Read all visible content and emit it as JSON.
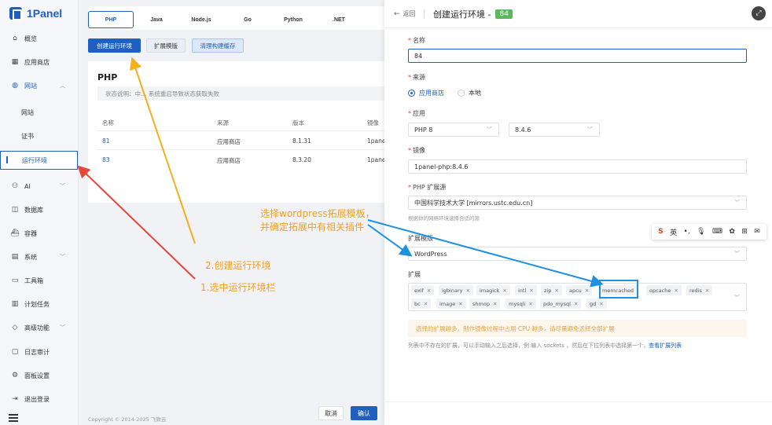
{
  "brand": "1Panel",
  "sidebar": {
    "items": [
      {
        "label": "概览",
        "icon": "home-icon"
      },
      {
        "label": "应用商店",
        "icon": "apps-icon"
      },
      {
        "label": "网站",
        "icon": "globe-icon"
      },
      {
        "label": "网站",
        "icon": ""
      },
      {
        "label": "证书",
        "icon": ""
      },
      {
        "label": "运行环境",
        "icon": ""
      },
      {
        "label": "AI",
        "icon": "robot-icon"
      },
      {
        "label": "数据库",
        "icon": "database-icon"
      },
      {
        "label": "容器",
        "icon": "container-icon"
      },
      {
        "label": "系统",
        "icon": "system-icon"
      },
      {
        "label": "工具箱",
        "icon": "toolbox-icon"
      },
      {
        "label": "计划任务",
        "icon": "schedule-icon"
      },
      {
        "label": "高级功能",
        "icon": "diamond-icon"
      },
      {
        "label": "日志审计",
        "icon": "log-icon"
      },
      {
        "label": "面板设置",
        "icon": "settings-icon"
      },
      {
        "label": "退出登录",
        "icon": "logout-icon"
      }
    ]
  },
  "runtime_tabs": [
    "PHP",
    "Java",
    "Node.js",
    "Go",
    "Python",
    ".NET"
  ],
  "toolbar": {
    "create": "创建运行环境",
    "extension_template": "扩展模版",
    "clear_cache": "清理构建缓存"
  },
  "panel": {
    "title": "PHP",
    "status": "状态说明：中… 系统重启导致状态获取失败",
    "columns": [
      "名称",
      "来源",
      "版本",
      "镜像"
    ],
    "rows": [
      {
        "name": "81",
        "source": "应用商店",
        "version": "8.1.31",
        "image": "1pane"
      },
      {
        "name": "83",
        "source": "应用商店",
        "version": "8.3.20",
        "image": "1pane"
      }
    ]
  },
  "footer": "Copyright © 2014-2025 飞致云",
  "annotations": {
    "wp_line1": "选择wordpress拓展模板，",
    "wp_line2": "并确定拓展中有相关插件",
    "step2": "2.创建运行环境",
    "step1": "1.选中运行环境栏"
  },
  "drawer": {
    "back": "返回",
    "title": "创建运行环境 -",
    "title_tag": "84",
    "fields": {
      "name_label": "名称",
      "name_value": "84",
      "source_label": "来源",
      "source_options": [
        "应用商店",
        "本地"
      ],
      "app_label": "应用",
      "app_value": "PHP 8",
      "version_value": "8.4.6",
      "image_label": "镜像",
      "image_value": "1panel-php:8.4.6",
      "ext_source_label": "PHP 扩展源",
      "ext_source_value": "中国科学技术大学 [mirrors.ustc.edu.cn]",
      "ext_source_hint": "根据你的网络环境选择合适的源",
      "template_label": "扩展模版",
      "template_value": "WordPress",
      "extensions_label": "扩展",
      "extensions": [
        "exif",
        "igbinary",
        "imagick",
        "intl",
        "zip",
        "apcu",
        "memcached",
        "opcache",
        "redis",
        "bc",
        "image",
        "shmop",
        "mysqli",
        "pdo_mysql",
        "gd"
      ]
    },
    "warning": "选择的扩展越多，制作镜像过程中占用 CPU 越多，请尽量避免选择全部扩展",
    "note": "列表中不存在的扩展，可以手动输入之后选择，例:输入 sockets ，然后在下拉列表中选择第一个，",
    "note_link": "查看扩展列表",
    "cancel": "取消",
    "confirm": "确认"
  },
  "ime": {
    "lang": "英"
  },
  "colors": {
    "primary": "#1f5fbf",
    "annotation_orange": "#f0a020",
    "arrow_red": "#e8453c",
    "arrow_blue": "#1e90e0",
    "tag_green": "#5cb85c"
  }
}
